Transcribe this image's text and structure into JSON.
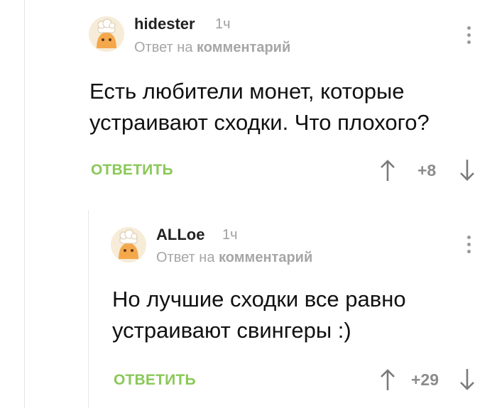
{
  "comments": [
    {
      "username": "hidester",
      "time": "1ч",
      "reply_prefix": "Ответ на",
      "reply_target": "комментарий",
      "text_lines": [
        "Есть любители монет, которые",
        "устраивают сходки. Что плохого?"
      ],
      "reply_label": "ОТВЕТИТЬ",
      "rating": "+8",
      "avatar_icon": "default-avatar-icon"
    },
    {
      "username": "ALLoe",
      "time": "1ч",
      "reply_prefix": "Ответ на",
      "reply_target": "комментарий",
      "text_lines": [
        "Но лучшие сходки все равно",
        "устраивают свингеры :)"
      ],
      "reply_label": "ОТВЕТИТЬ",
      "rating": "+29",
      "avatar_icon": "default-avatar-icon"
    }
  ],
  "colors": {
    "accent": "#8ac858",
    "muted": "#a6a6a6",
    "text": "#111111",
    "thread_line": "#e6e6e6"
  }
}
